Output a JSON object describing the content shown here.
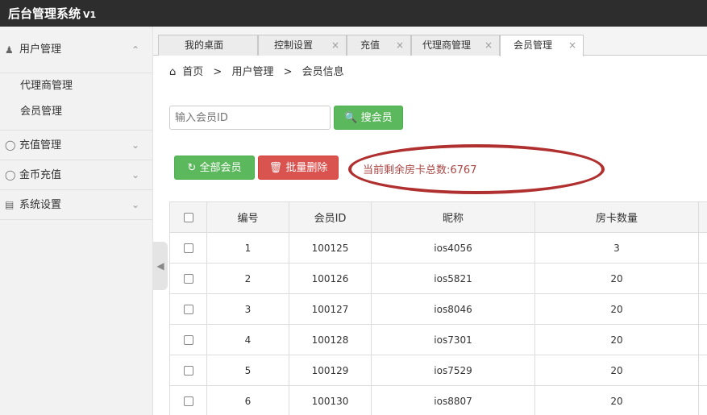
{
  "app": {
    "title": "后台管理系统",
    "version": "V1"
  },
  "sidebar": {
    "groups": [
      {
        "icon": "user-group-icon",
        "label": "用户管理",
        "expanded": true,
        "items": [
          "代理商管理",
          "会员管理"
        ]
      },
      {
        "icon": "recharge-icon",
        "label": "充值管理",
        "expanded": false
      },
      {
        "icon": "coin-icon",
        "label": "金币充值",
        "expanded": false
      },
      {
        "icon": "settings-icon",
        "label": "系统设置",
        "expanded": false
      }
    ]
  },
  "tabs": [
    {
      "label": "我的桌面",
      "closable": false,
      "active": false
    },
    {
      "label": "控制设置",
      "closable": true,
      "active": false
    },
    {
      "label": "充值",
      "closable": true,
      "active": false
    },
    {
      "label": "代理商管理",
      "closable": true,
      "active": false
    },
    {
      "label": "会员管理",
      "closable": true,
      "active": true
    }
  ],
  "breadcrumb": {
    "home": "首页",
    "sep": ">",
    "level1": "用户管理",
    "level2": "会员信息"
  },
  "search": {
    "placeholder": "输入会员ID",
    "value": "",
    "button": "搜会员"
  },
  "actions": {
    "all_members": "全部会员",
    "batch_delete": "批量删除"
  },
  "room_card_text": "当前剩余房卡总数:6767",
  "table": {
    "columns": [
      "编号",
      "会员ID",
      "昵称",
      "房卡数量"
    ],
    "rows": [
      [
        "1",
        "100125",
        "ios4056",
        "3"
      ],
      [
        "2",
        "100126",
        "ios5821",
        "20"
      ],
      [
        "3",
        "100127",
        "ios8046",
        "20"
      ],
      [
        "4",
        "100128",
        "ios7301",
        "20"
      ],
      [
        "5",
        "100129",
        "ios7529",
        "20"
      ],
      [
        "6",
        "100130",
        "ios8807",
        "20"
      ]
    ]
  },
  "colors": {
    "topbar": "#2d2d2d",
    "success": "#5cb85c",
    "danger": "#d9534f",
    "highlight_ring": "#b03030"
  }
}
